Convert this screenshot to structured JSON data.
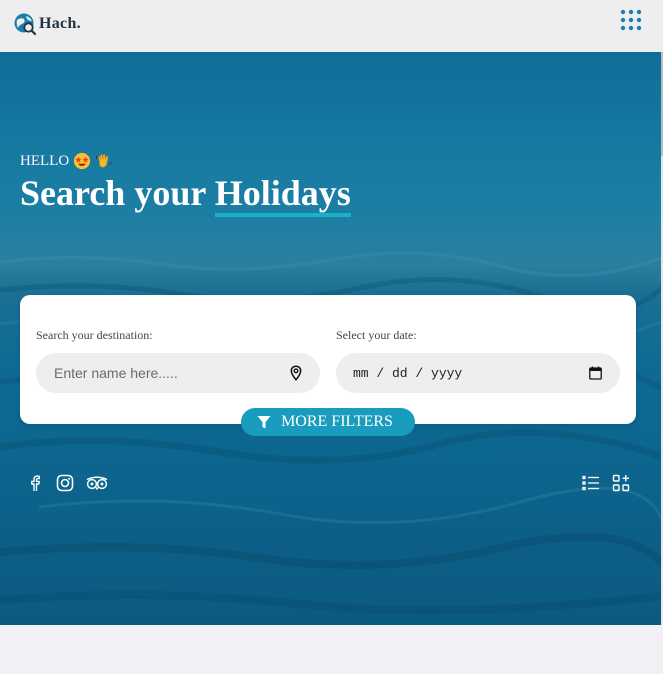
{
  "header": {
    "brand": "Hach.",
    "icons": [
      "globe-search-icon",
      "grid-menu-icon"
    ]
  },
  "hero": {
    "greeting": "HELLO",
    "greeting_emojis": [
      "star-struck-emoji-icon",
      "waving-hand-emoji-icon"
    ],
    "headline_prefix": "Search your ",
    "headline_highlight": "Holidays"
  },
  "search": {
    "destination_label": "Search your destination:",
    "destination_placeholder": "Enter name here.....",
    "destination_value": "",
    "date_label": "Select your date:",
    "date_placeholder": "mm / dd / yyyy"
  },
  "filters": {
    "button_label": "MORE FILTERS"
  },
  "social": {
    "left": [
      "facebook-icon",
      "instagram-icon",
      "tripadvisor-icon"
    ],
    "right": [
      "list-view-icon",
      "grid-add-icon"
    ]
  },
  "colors": {
    "accent": "#1a9cbf",
    "underline": "#16b0c9",
    "header_bg": "#eeeeee",
    "brand_text": "#223041"
  }
}
